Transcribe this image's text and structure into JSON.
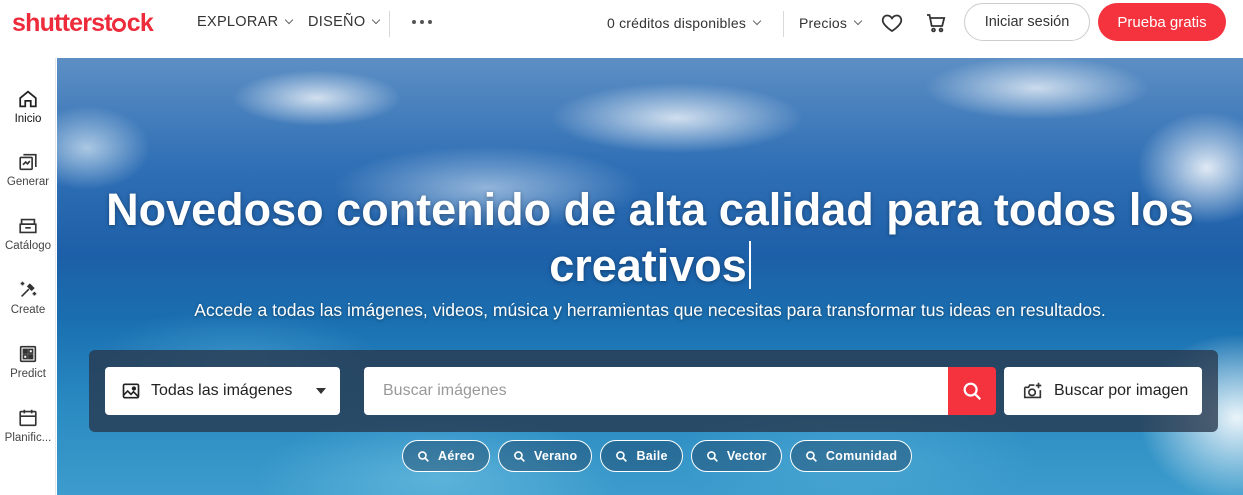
{
  "header": {
    "logo": "shutterstock",
    "nav": [
      {
        "label": "EXPLORAR"
      },
      {
        "label": "DISEÑO"
      }
    ],
    "credits": "0 créditos disponibles",
    "prices": "Precios",
    "login_label": "Iniciar sesión",
    "trial_label": "Prueba gratis"
  },
  "sidebar": {
    "items": [
      {
        "label": "Inicio",
        "icon": "home-icon"
      },
      {
        "label": "Generar",
        "icon": "generate-icon"
      },
      {
        "label": "Catálogo",
        "icon": "catalog-icon"
      },
      {
        "label": "Create",
        "icon": "create-icon"
      },
      {
        "label": "Predict",
        "icon": "predict-icon"
      },
      {
        "label": "Planific...",
        "icon": "calendar-icon"
      }
    ]
  },
  "hero": {
    "title_line1": "Novedoso contenido de alta calidad para todos los",
    "title_line2": "creativos",
    "subtitle": "Accede a todas las imágenes, videos, música y herramientas que necesitas para transformar tus ideas en resultados."
  },
  "search": {
    "type_label": "Todas las imágenes",
    "placeholder": "Buscar imágenes",
    "image_search_label": "Buscar por imagen"
  },
  "chips": [
    {
      "label": "Aéreo"
    },
    {
      "label": "Verano"
    },
    {
      "label": "Baile"
    },
    {
      "label": "Vector"
    },
    {
      "label": "Comunidad"
    }
  ],
  "colors": {
    "brand": "#ee2b3b",
    "cta": "#f5333f"
  }
}
